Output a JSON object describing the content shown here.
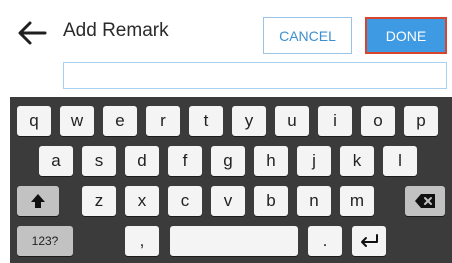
{
  "header": {
    "back_icon": "arrow-left-icon",
    "title": "Add Remark",
    "cancel_label": "CANCEL",
    "done_label": "DONE"
  },
  "remark": {
    "value": ""
  },
  "keyboard": {
    "row1": [
      "q",
      "w",
      "e",
      "r",
      "t",
      "y",
      "u",
      "i",
      "o",
      "p"
    ],
    "row2": [
      "a",
      "s",
      "d",
      "f",
      "g",
      "h",
      "j",
      "k",
      "l"
    ],
    "row3": [
      "z",
      "x",
      "c",
      "v",
      "b",
      "n",
      "m"
    ],
    "row4": {
      "symbols": "123?",
      "comma": ",",
      "period": "."
    },
    "icons": {
      "shift": "shift-up-arrow-icon",
      "backspace": "backspace-icon",
      "enter": "enter-return-icon"
    }
  },
  "colors": {
    "accent_blue": "#3e9be3",
    "done_border": "#d9452c",
    "keyboard_bg": "#3b3b3b",
    "key_bg": "#f4f4f4"
  }
}
